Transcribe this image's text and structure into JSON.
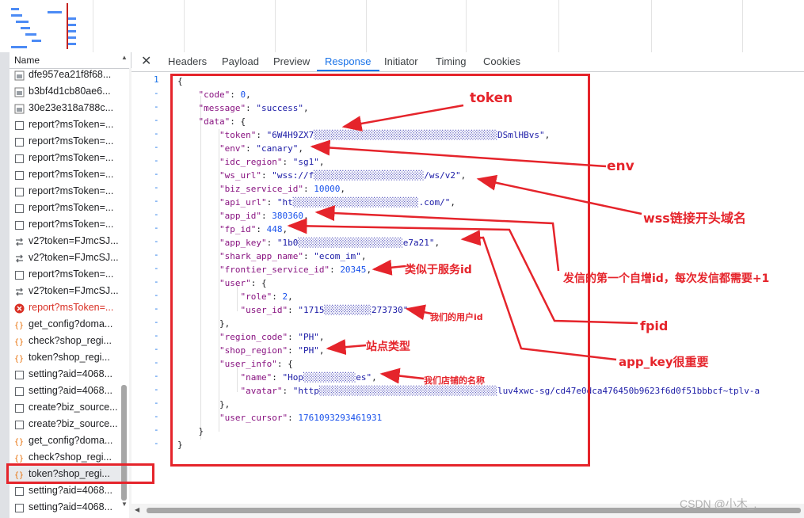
{
  "devtools": {
    "name_header": "Name",
    "tabs": [
      "Headers",
      "Payload",
      "Preview",
      "Response",
      "Initiator",
      "Timing",
      "Cookies"
    ],
    "active_tab": "Response",
    "close_icon": "close-icon"
  },
  "requests": [
    {
      "name": "dfe957ea21f8f68...",
      "icon": "image-icon"
    },
    {
      "name": "b3bf4d1cb80ae6...",
      "icon": "image-icon"
    },
    {
      "name": "30e23e318a788c...",
      "icon": "image-icon"
    },
    {
      "name": "report?msToken=...",
      "icon": "document-icon"
    },
    {
      "name": "report?msToken=...",
      "icon": "document-icon"
    },
    {
      "name": "report?msToken=...",
      "icon": "document-icon"
    },
    {
      "name": "report?msToken=...",
      "icon": "document-icon"
    },
    {
      "name": "report?msToken=...",
      "icon": "document-icon"
    },
    {
      "name": "report?msToken=...",
      "icon": "document-icon"
    },
    {
      "name": "report?msToken=...",
      "icon": "document-icon"
    },
    {
      "name": "v2?token=FJmcSJ...",
      "icon": "websocket-icon"
    },
    {
      "name": "v2?token=FJmcSJ...",
      "icon": "websocket-icon"
    },
    {
      "name": "report?msToken=...",
      "icon": "document-icon"
    },
    {
      "name": "v2?token=FJmcSJ...",
      "icon": "websocket-icon"
    },
    {
      "name": "report?msToken=...",
      "icon": "error-icon",
      "error": true
    },
    {
      "name": "get_config?doma...",
      "icon": "json-icon"
    },
    {
      "name": "check?shop_regi...",
      "icon": "json-icon"
    },
    {
      "name": "token?shop_regi...",
      "icon": "json-icon"
    },
    {
      "name": "setting?aid=4068...",
      "icon": "document-icon"
    },
    {
      "name": "setting?aid=4068...",
      "icon": "document-icon"
    },
    {
      "name": "create?biz_source...",
      "icon": "document-icon"
    },
    {
      "name": "create?biz_source...",
      "icon": "document-icon"
    },
    {
      "name": "get_config?doma...",
      "icon": "json-icon"
    },
    {
      "name": "check?shop_regi...",
      "icon": "json-icon"
    },
    {
      "name": "token?shop_regi...",
      "icon": "json-icon",
      "selected": true
    },
    {
      "name": "setting?aid=4068...",
      "icon": "document-icon"
    },
    {
      "name": "setting?aid=4068...",
      "icon": "document-icon"
    }
  ],
  "gutter": [
    "1",
    "-",
    "-",
    "-",
    "-",
    "-",
    "-",
    "-",
    "-",
    "-",
    "-",
    "-",
    "-",
    "-",
    "-",
    "-",
    "-",
    "-",
    "-",
    "-",
    "-",
    "-",
    "-",
    "-",
    "-",
    "-",
    "-",
    "-"
  ],
  "code_lines": [
    [
      "{"
    ],
    [
      "    ",
      "\"code\"",
      ": ",
      "0",
      ","
    ],
    [
      "    ",
      "\"message\"",
      ": ",
      "\"success\"",
      ","
    ],
    [
      "    ",
      "\"data\"",
      ": {"
    ],
    [
      "        ",
      "\"token\"",
      ": ",
      "\"6W4H9ZX7░░░░░░░░░░░░░░░░░░░░░░░░░░░░░░░░░░░DSmlHBvs\"",
      ","
    ],
    [
      "        ",
      "\"env\"",
      ": ",
      "\"canary\"",
      ","
    ],
    [
      "        ",
      "\"idc_region\"",
      ": ",
      "\"sg1\"",
      ","
    ],
    [
      "        ",
      "\"ws_url\"",
      ": ",
      "\"wss://f░░░░░░░░░░░░░░░░░░░░░/ws/v2\"",
      ","
    ],
    [
      "        ",
      "\"biz_service_id\"",
      ": ",
      "10000",
      ","
    ],
    [
      "        ",
      "\"api_url\"",
      ": ",
      "\"ht░░░░░░░░░░░░░░░░░░░░░░░░.com/\"",
      ","
    ],
    [
      "        ",
      "\"app_id\"",
      ": ",
      "380360",
      ","
    ],
    [
      "        ",
      "\"fp_id\"",
      ": ",
      "448",
      ","
    ],
    [
      "        ",
      "\"app_key\"",
      ": ",
      "\"1b0░░░░░░░░░░░░░░░░░░░░e7a21\"",
      ","
    ],
    [
      "        ",
      "\"shark_app_name\"",
      ": ",
      "\"ecom_im\"",
      ","
    ],
    [
      "        ",
      "\"frontier_service_id\"",
      ": ",
      "20345",
      ","
    ],
    [
      "        ",
      "\"user\"",
      ": {"
    ],
    [
      "            ",
      "\"role\"",
      ": ",
      "2",
      ","
    ],
    [
      "            ",
      "\"user_id\"",
      ": ",
      "\"1715░░░░░░░░░273730\""
    ],
    [
      "        },"
    ],
    [
      "        ",
      "\"region_code\"",
      ": ",
      "\"PH\"",
      ","
    ],
    [
      "        ",
      "\"shop_region\"",
      ": ",
      "\"PH\"",
      ","
    ],
    [
      "        ",
      "\"user_info\"",
      ": {"
    ],
    [
      "            ",
      "\"name\"",
      ": ",
      "\"Hop░░░░░░░░░░es\"",
      ","
    ],
    [
      "            ",
      "\"avatar\"",
      ": ",
      "\"http░░░░░░░░░░░░░░░░░░░░░░░░░░░░░░░░░░luv4xwc-sg/cd47e0dca476450b9623f6d0f51bbbcf~tplv-a"
    ],
    [
      "        },"
    ],
    [
      "        ",
      "\"user_cursor\"",
      ": ",
      "1761093293461931"
    ],
    [
      "    }"
    ],
    [
      "}"
    ]
  ],
  "annotations": {
    "token": "token",
    "env": "env",
    "wss": "wss链接开头域名",
    "service_id": "类似于服务id",
    "increment": "发信的第一个自增id，每次发信都需要+1",
    "user_id": "我们的用户id",
    "fpid": "fpid",
    "site_type": "站点类型",
    "app_key": "app_key很重要",
    "shop_name": "我们店铺的名称"
  },
  "watermark": "CSDN @小木_.",
  "colors": {
    "annotation_red": "#e5242b",
    "json_key": "#881280",
    "json_string": "#1a1aa6",
    "json_number": "#1750eb",
    "active_tab": "#1a73e8"
  }
}
